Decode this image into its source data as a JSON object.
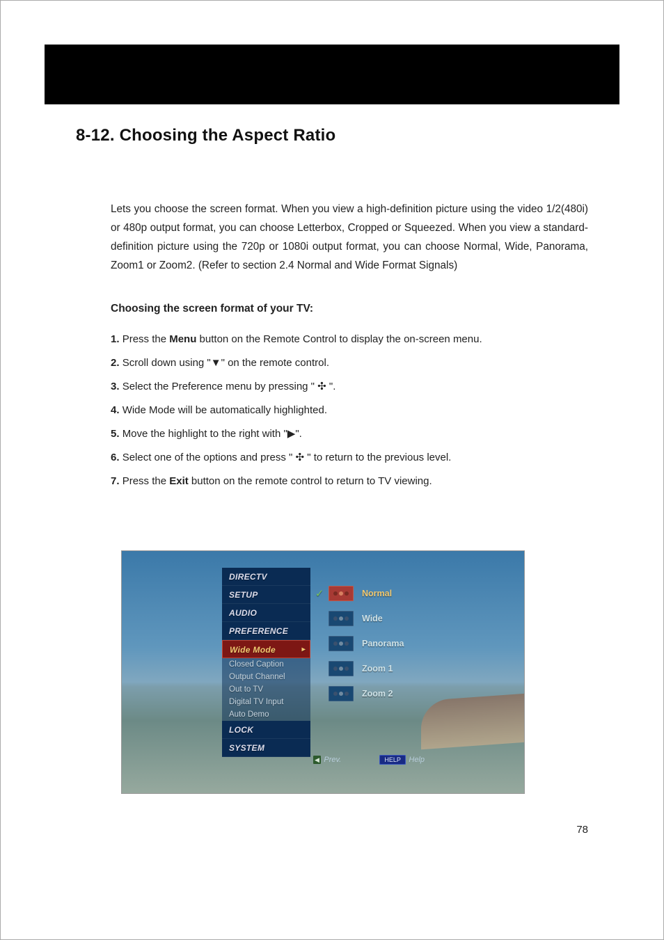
{
  "heading": "8-12. Choosing the Aspect Ratio",
  "intro": "Lets you choose the screen format.  When you view a high-definition picture using the video 1/2(480i) or 480p output format, you can choose Letterbox, Cropped or Squeezed.  When you view a standard-definition picture using the 720p or 1080i output format, you can choose Normal, Wide, Panorama, Zoom1 or Zoom2.  (Refer to section 2.4 Normal and Wide Format Signals)",
  "subhead": "Choosing the screen format of your TV:",
  "steps": [
    {
      "num": "1.",
      "pre": "Press the ",
      "bold": "Menu",
      "post": " button on the Remote Control to display the on-screen menu."
    },
    {
      "num": "2.",
      "pre": "Scroll down using \"▼\" on the remote control.",
      "bold": "",
      "post": ""
    },
    {
      "num": "3.",
      "pre": "Select the Preference menu by pressing \" ✣ \".",
      "bold": "",
      "post": ""
    },
    {
      "num": "4.",
      "pre": "Wide Mode will be automatically highlighted.",
      "bold": "",
      "post": ""
    },
    {
      "num": "5.",
      "pre": "Move the highlight to the right with \"▶\".",
      "bold": "",
      "post": ""
    },
    {
      "num": "6.",
      "pre": "Select one of the options and press \" ✣ \" to return to the previous level.",
      "bold": "",
      "post": ""
    },
    {
      "num": "7.",
      "pre": "Press the ",
      "bold": "Exit",
      "post": " button on the remote control to return to TV viewing."
    }
  ],
  "screenshot": {
    "menu_categories": [
      "DIRECTV",
      "SETUP",
      "AUDIO",
      "PREFERENCE"
    ],
    "menu_selected": "Wide Mode",
    "menu_subitems": [
      "Closed Caption",
      "Output Channel",
      "Out to TV",
      "Digital TV Input",
      "Auto Demo"
    ],
    "menu_bottom": [
      "LOCK",
      "SYSTEM"
    ],
    "options": [
      {
        "label": "Normal",
        "selected": true
      },
      {
        "label": "Wide",
        "selected": false
      },
      {
        "label": "Panorama",
        "selected": false
      },
      {
        "label": "Zoom 1",
        "selected": false
      },
      {
        "label": "Zoom 2",
        "selected": false
      }
    ],
    "footer": {
      "prev_indicator": "◀",
      "prev_label": "Prev.",
      "help_indicator": "HELP",
      "help_label": "Help"
    }
  },
  "page_number": "78"
}
